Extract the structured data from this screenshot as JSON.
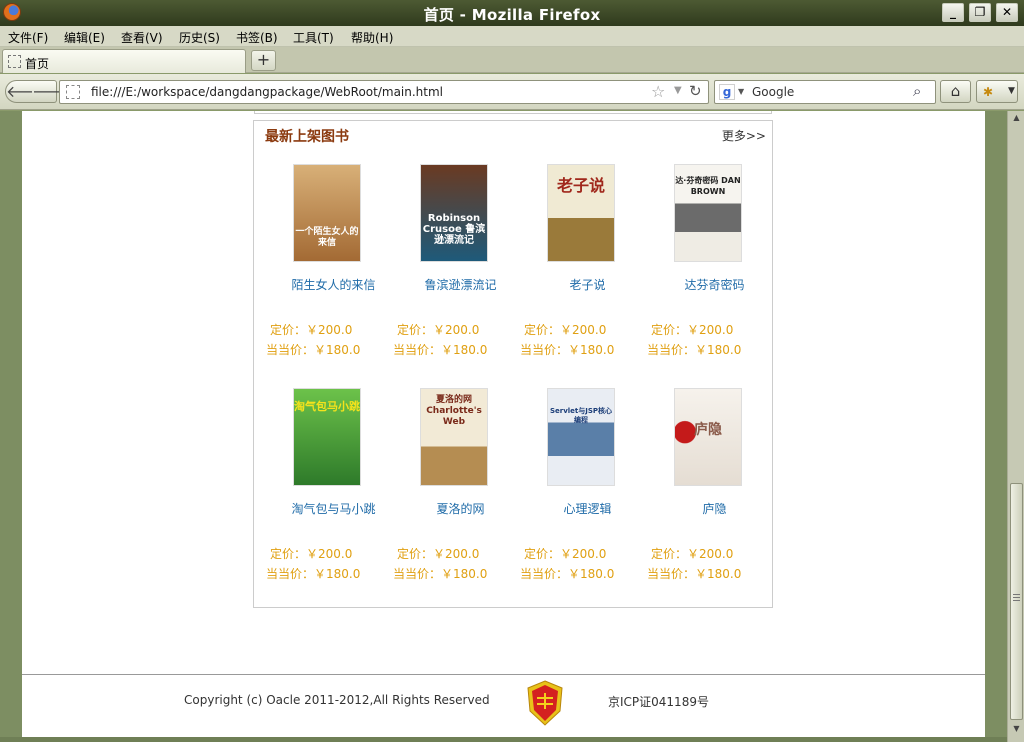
{
  "window": {
    "title": "首页 - Mozilla Firefox"
  },
  "menu": [
    "文件(F)",
    "编辑(E)",
    "查看(V)",
    "历史(S)",
    "书签(B)",
    "工具(T)",
    "帮助(H)"
  ],
  "tab": {
    "label": "首页",
    "new_tab": "+"
  },
  "navbar": {
    "url": "file:///E:/workspace/dangdangpackage/WebRoot/main.html",
    "search_engine": "Google",
    "search_placeholder": "Google"
  },
  "panel": {
    "heading": "最新上架图书",
    "more": "更多>>"
  },
  "books": [
    {
      "name": "陌生女人的来信",
      "price": "定价：￥200.0",
      "dang_price": "当当价：￥180.0",
      "cover_text": "一个陌生女人的来信",
      "cover_color": "#c89a5a"
    },
    {
      "name": "鲁滨逊漂流记",
      "price": "定价：￥200.0",
      "dang_price": "当当价：￥180.0",
      "cover_text": "Robinson Crusoe 鲁滨逊漂流记",
      "cover_color": "#1e5a7a"
    },
    {
      "name": "老子说",
      "price": "定价：￥200.0",
      "dang_price": "当当价：￥180.0",
      "cover_text": "老子说",
      "cover_color": "#e9e2c9"
    },
    {
      "name": "达芬奇密码",
      "price": "定价：￥200.0",
      "dang_price": "当当价：￥180.0",
      "cover_text": "达·芬奇密码 DAN BROWN",
      "cover_color": "#f2f0ea"
    },
    {
      "name": "淘气包与马小跳",
      "price": "定价：￥200.0",
      "dang_price": "当当价：￥180.0",
      "cover_text": "淘气包马小跳",
      "cover_color": "#4fa43c"
    },
    {
      "name": "夏洛的网",
      "price": "定价：￥200.0",
      "dang_price": "当当价：￥180.0",
      "cover_text": "夏洛的网 Charlotte's Web",
      "cover_color": "#efe6d0"
    },
    {
      "name": "心理逻辑",
      "price": "定价：￥200.0",
      "dang_price": "当当价：￥180.0",
      "cover_text": "Servlet与JSP核心编程",
      "cover_color": "#e8ecf2"
    },
    {
      "name": "庐隐",
      "price": "定价：￥200.0",
      "dang_price": "当当价：￥180.0",
      "cover_text": "庐隐",
      "cover_color": "#f3eee8"
    }
  ],
  "footer": {
    "copyright": "Copyright (c) Oacle 2011-2012,All Rights Reserved",
    "icp": "京ICP证041189号"
  },
  "colors": {
    "accent_price": "#e0a012",
    "book_link": "#1f6ba8",
    "heading": "#8b3a0f"
  }
}
